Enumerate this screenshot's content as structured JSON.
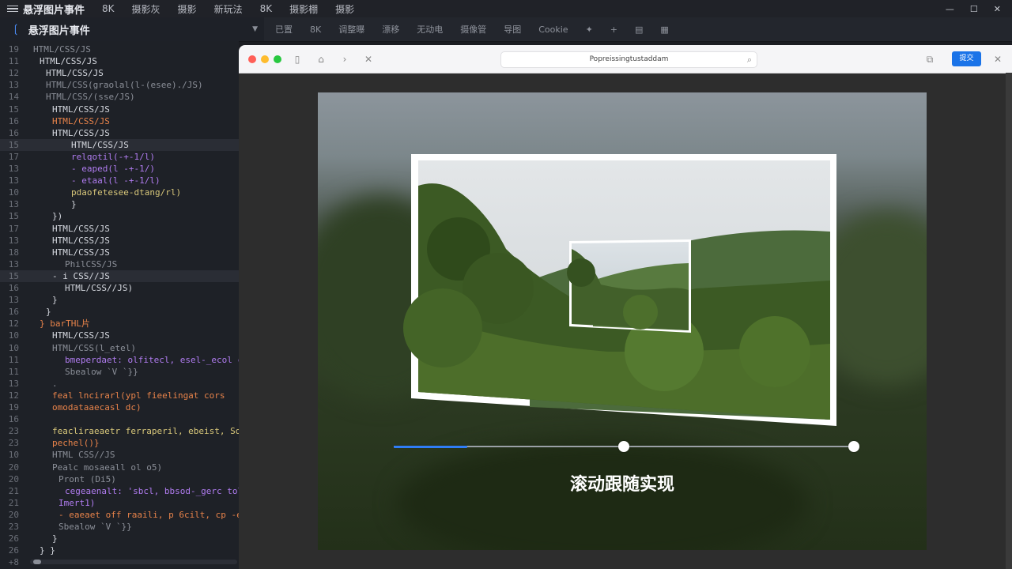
{
  "topbar": {
    "title": "悬浮图片事件",
    "menu": [
      "8K",
      "摄影灰",
      "摄影",
      "新玩法",
      "8K",
      "摄影棚",
      "摄影"
    ]
  },
  "editor_tab": {
    "filename": "悬浮图片事件"
  },
  "toolbar2": [
    "已置",
    "8K",
    "调整曝",
    "漂移",
    "无动电",
    "摄像管",
    "导图",
    "Cookie"
  ],
  "code_lines": [
    {
      "n": "19",
      "t": "HTML/CSS/JS",
      "c": "c-g",
      "i": 0
    },
    {
      "n": "11",
      "t": "HTML/CSS/JS",
      "c": "c-w",
      "i": 1
    },
    {
      "n": "12",
      "t": "HTML/CSS/JS",
      "c": "c-w",
      "i": 2
    },
    {
      "n": "13",
      "t": "HTML/CSS(graolal(l-(esee)./JS)",
      "c": "c-g",
      "i": 2
    },
    {
      "n": "14",
      "t": "HTML/CSS/(sse/JS)",
      "c": "c-g",
      "i": 2
    },
    {
      "n": "15",
      "t": "HTML/CSS/JS",
      "c": "c-w",
      "i": 3
    },
    {
      "n": "16",
      "t": "HTML/CSS/JS",
      "c": "c-o",
      "i": 3
    },
    {
      "n": "16",
      "t": "HTML/CSS/JS",
      "c": "c-w",
      "i": 3
    },
    {
      "n": "15",
      "t": "HTML/CSS/JS",
      "c": "c-w",
      "i": 6
    },
    {
      "n": "17",
      "t": "relqotil(-+-1/l)",
      "c": "c-p",
      "i": 6
    },
    {
      "n": "13",
      "t": "- eaped(l -+-1/)",
      "c": "c-p",
      "i": 6
    },
    {
      "n": "13",
      "t": "- etaal(l -+-1/l)",
      "c": "c-p",
      "i": 6
    },
    {
      "n": "10",
      "t": "  pdaofetesee-dtang/rl)",
      "c": "c-y",
      "i": 6
    },
    {
      "n": "13",
      "t": "}",
      "c": "c-w",
      "i": 6
    },
    {
      "n": "15",
      "t": "})",
      "c": "c-w",
      "i": 3
    },
    {
      "n": "17",
      "t": "HTML/CSS/JS",
      "c": "c-w",
      "i": 3
    },
    {
      "n": "13",
      "t": "HTML/CSS/JS",
      "c": "c-w",
      "i": 3
    },
    {
      "n": "18",
      "t": "HTML/CSS/JS",
      "c": "c-w",
      "i": 3
    },
    {
      "n": "13",
      "t": "PhilCSS/JS",
      "c": "c-g",
      "i": 5
    },
    {
      "n": "15",
      "t": "- i CSS//JS",
      "c": "c-w",
      "i": 3
    },
    {
      "n": "16",
      "t": "HTML/CSS//JS)",
      "c": "c-w",
      "i": 5
    },
    {
      "n": "13",
      "t": "}",
      "c": "c-w",
      "i": 3
    },
    {
      "n": "16",
      "t": "}",
      "c": "c-w",
      "i": 2
    },
    {
      "n": "12",
      "t": "} barTHL片",
      "c": "c-o",
      "i": 1
    },
    {
      "n": "10",
      "t": "HTML/CSS/JS",
      "c": "c-w",
      "i": 3
    },
    {
      "n": "10",
      "t": "HTML/CSS(l_etel)",
      "c": "c-g",
      "i": 3
    },
    {
      "n": "11",
      "t": "bmeperdaet: olfitecl, esel-_ecol c",
      "c": "c-p",
      "i": 5
    },
    {
      "n": "11",
      "t": "Sbealow `V `}}",
      "c": "c-g",
      "i": 5
    },
    {
      "n": "13",
      "t": ".",
      "c": "c-g",
      "i": 3
    },
    {
      "n": "12",
      "t": "feal lncirarl(ypl fieelingat cors",
      "c": "c-o",
      "i": 3
    },
    {
      "n": "19",
      "t": "omodataaecasl  dc)",
      "c": "c-o",
      "i": 3
    },
    {
      "n": "16",
      "t": "",
      "c": "c-g",
      "i": 3
    },
    {
      "n": "23",
      "t": "feacliraeaetr ferraperil, ebeist, Sonp",
      "c": "c-y",
      "i": 3
    },
    {
      "n": "23",
      "t": "pechel()}",
      "c": "c-o",
      "i": 3
    },
    {
      "n": "10",
      "t": "HTML CSS//JS",
      "c": "c-g",
      "i": 3
    },
    {
      "n": "20",
      "t": "Pealc mosaeall ol o5)",
      "c": "c-g",
      "i": 3
    },
    {
      "n": "20",
      "t": "Pront (Di5)",
      "c": "c-g",
      "i": 4
    },
    {
      "n": "21",
      "t": "cegeaenalt: 'sbcl, bbsod-_gerc tolu",
      "c": "c-p",
      "i": 5
    },
    {
      "n": "21",
      "t": "Imert1)",
      "c": "c-p",
      "i": 4
    },
    {
      "n": "20",
      "t": "- eaeaet off raaili, p 6cilt, cp -eoo",
      "c": "c-o",
      "i": 4
    },
    {
      "n": "23",
      "t": "Sbealow `V `}}",
      "c": "c-g",
      "i": 4
    },
    {
      "n": "26",
      "t": "}",
      "c": "c-w",
      "i": 3
    },
    {
      "n": "26",
      "t": "} }",
      "c": "c-w",
      "i": 1
    },
    {
      "n": "+8",
      "t": "",
      "c": "c-g",
      "i": 0
    }
  ],
  "browser": {
    "url": "Popreissingtustaddam",
    "button_label": "提交"
  },
  "caption": "滚动跟随实现",
  "slider": {
    "progress": 0.16,
    "handle_values": [
      0.5,
      1.0
    ]
  },
  "colors": {
    "accent": "#2f7df6",
    "editor_bg": "#1e2127",
    "browser_btn": "#1a73e8"
  }
}
